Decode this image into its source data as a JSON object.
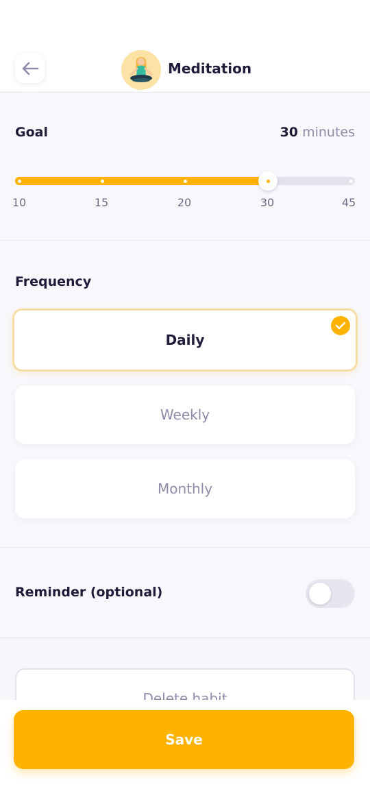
{
  "header": {
    "title": "Meditation",
    "back_icon": "arrow-left-icon",
    "avatar_icon": "meditation-person-icon"
  },
  "goal": {
    "label": "Goal",
    "value": "30",
    "unit": "minutes",
    "slider": {
      "min": 10,
      "max": 45,
      "current": 30,
      "ticks": [
        "10",
        "15",
        "20",
        "30",
        "45"
      ]
    }
  },
  "frequency": {
    "label": "Frequency",
    "options": [
      {
        "label": "Daily",
        "selected": true
      },
      {
        "label": "Weekly",
        "selected": false
      },
      {
        "label": "Monthly",
        "selected": false
      }
    ]
  },
  "reminder": {
    "label": "Reminder (optional)",
    "enabled": false
  },
  "delete_label": "Delete habit",
  "save_label": "Save",
  "colors": {
    "accent": "#ffb300",
    "text_primary": "#1f1d3a",
    "text_secondary": "#8e8aa8",
    "background": "#f8f8fc"
  }
}
